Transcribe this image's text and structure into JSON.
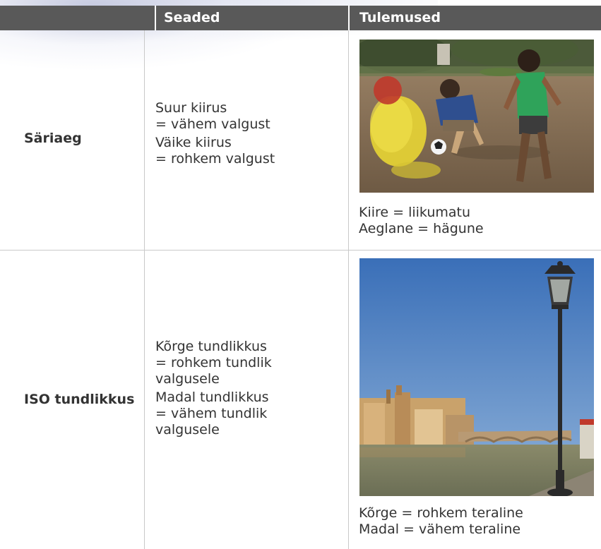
{
  "table": {
    "headers": {
      "settings": "Seaded",
      "results": "Tulemused"
    },
    "rows": [
      {
        "label": "Säriaeg",
        "settings": [
          "Suur kiirus",
          "= vähem valgust",
          "Väike kiirus",
          "= rohkem valgust"
        ],
        "caption": [
          "Kiire = liikumatu",
          "Aeglane = hägune"
        ]
      },
      {
        "label": "ISO tundlikkus",
        "settings": [
          "Kõrge tundlikkus",
          "= rohkem tundlik",
          "valgusele",
          "Madal tundlikkus",
          "= vähem tundlik",
          "valgusele"
        ],
        "caption": [
          "Kõrge = rohkem teraline",
          "Madal = vähem teraline"
        ]
      }
    ]
  },
  "colors": {
    "header_bg": "#595959",
    "header_text": "#ffffff",
    "grid_line": "#c9c9c9",
    "body_text": "#333333"
  },
  "icons": {
    "photo_1": "children-playing-football-photo",
    "photo_2": "street-lamp-river-photo"
  }
}
